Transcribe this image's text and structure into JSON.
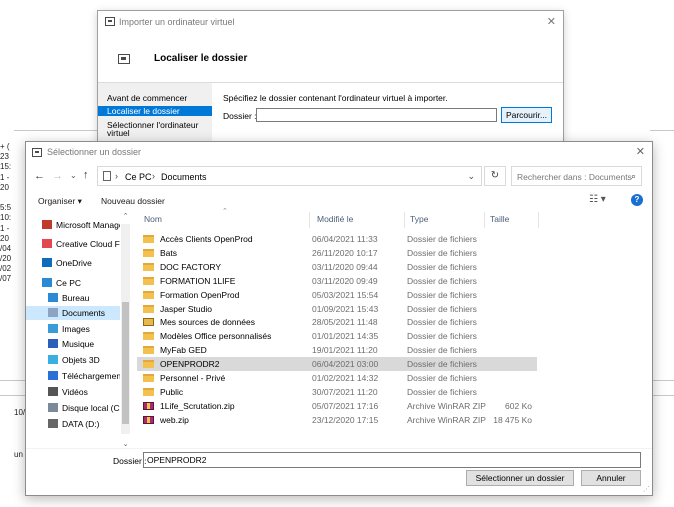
{
  "background": {
    "left_text_lines": [
      "+ (",
      "23",
      "15:",
      "1 -",
      "20",
      "",
      "5:5",
      "10:",
      "1 -",
      "20",
      "/04",
      "/20",
      "/02",
      "/07"
    ],
    "bottom_text_a": "10/",
    "bottom_text_b": "un"
  },
  "import_dialog": {
    "title": "Importer un ordinateur virtuel",
    "close_glyph": "✕",
    "header": "Localiser le dossier",
    "nav": [
      "Avant de commencer",
      "Localiser le dossier",
      "Sélectionner l'ordinateur",
      "virtuel"
    ],
    "instruction": "Spécifiez le dossier contenant l'ordinateur virtuel à importer.",
    "folder_label": "Dossier :",
    "folder_value": "",
    "browse_label": "Parcourir..."
  },
  "folder_dialog": {
    "title": "Sélectionner un dossier",
    "close_glyph": "✕",
    "nav_glyphs": {
      "back": "←",
      "forward": "→",
      "recent": "⌄",
      "up": "↑",
      "sep": "›",
      "dropdown": "⌄",
      "refresh": "↻",
      "search": "⌕",
      "view": "☷ ▾",
      "help": "?",
      "scroll_up": "⌃",
      "scroll_down": "⌄",
      "sort": "⌃",
      "grip": "⋰"
    },
    "breadcrumbs": [
      "Ce PC",
      "Documents"
    ],
    "search_placeholder": "Rechercher dans : Documents",
    "toolbar": {
      "organize": "Organiser ▾",
      "new_folder": "Nouveau dossier"
    },
    "nav_pane": [
      {
        "label": "Microsoft Manage",
        "icon": "microsoft-manage-icon",
        "color": "#c0392b"
      },
      {
        "label": "Creative Cloud Fil",
        "icon": "creative-cloud-icon",
        "color": "#e34850"
      },
      {
        "label": "OneDrive",
        "icon": "onedrive-icon",
        "color": "#0f6cbd"
      },
      {
        "label": "Ce PC",
        "icon": "this-pc-icon",
        "color": "#2b8ad8"
      },
      {
        "label": "Bureau",
        "icon": "desktop-icon",
        "color": "#2b8ad8"
      },
      {
        "label": "Documents",
        "icon": "documents-icon",
        "color": "#8aa4c2"
      },
      {
        "label": "Images",
        "icon": "images-icon",
        "color": "#3a9bd9"
      },
      {
        "label": "Musique",
        "icon": "music-icon",
        "color": "#2b5fb8"
      },
      {
        "label": "Objets 3D",
        "icon": "objects-3d-icon",
        "color": "#3ab0e0"
      },
      {
        "label": "Téléchargements",
        "icon": "downloads-icon",
        "color": "#2b6fd8"
      },
      {
        "label": "Vidéos",
        "icon": "videos-icon",
        "color": "#555555"
      },
      {
        "label": "Disque local (C:)",
        "icon": "local-disk-icon",
        "color": "#7a8a9a"
      },
      {
        "label": "DATA (D:)",
        "icon": "data-drive-icon",
        "color": "#666666"
      }
    ],
    "columns": {
      "name": "Nom",
      "modified": "Modifié le",
      "type": "Type",
      "size": "Taille"
    },
    "files": [
      {
        "name": "Accès Clients OpenProd",
        "modified": "06/04/2021 11:33",
        "type": "Dossier de fichiers",
        "size": "",
        "kind": "folder"
      },
      {
        "name": "Bats",
        "modified": "26/11/2020 10:17",
        "type": "Dossier de fichiers",
        "size": "",
        "kind": "folder"
      },
      {
        "name": "DOC FACTORY",
        "modified": "03/11/2020 09:44",
        "type": "Dossier de fichiers",
        "size": "",
        "kind": "folder"
      },
      {
        "name": "FORMATION 1LIFE",
        "modified": "03/11/2020 09:49",
        "type": "Dossier de fichiers",
        "size": "",
        "kind": "folder"
      },
      {
        "name": "Formation OpenProd",
        "modified": "05/03/2021 15:54",
        "type": "Dossier de fichiers",
        "size": "",
        "kind": "folder"
      },
      {
        "name": "Jasper Studio",
        "modified": "01/09/2021 15:43",
        "type": "Dossier de fichiers",
        "size": "",
        "kind": "folder"
      },
      {
        "name": "Mes sources de données",
        "modified": "28/05/2021 11:48",
        "type": "Dossier de fichiers",
        "size": "",
        "kind": "special"
      },
      {
        "name": "Modèles Office personnalisés",
        "modified": "01/01/2021 14:35",
        "type": "Dossier de fichiers",
        "size": "",
        "kind": "folder"
      },
      {
        "name": "MyFab GED",
        "modified": "19/01/2021 11:20",
        "type": "Dossier de fichiers",
        "size": "",
        "kind": "folder"
      },
      {
        "name": "OPENPRODR2",
        "modified": "06/04/2021 03:00",
        "type": "Dossier de fichiers",
        "size": "",
        "kind": "folder",
        "selected": true
      },
      {
        "name": "Personnel - Privé",
        "modified": "01/02/2021 14:32",
        "type": "Dossier de fichiers",
        "size": "",
        "kind": "folder"
      },
      {
        "name": "Public",
        "modified": "30/07/2021 11:20",
        "type": "Dossier de fichiers",
        "size": "",
        "kind": "folder"
      },
      {
        "name": "1Life_Scrutation.zip",
        "modified": "05/07/2021 17:16",
        "type": "Archive WinRAR ZIP",
        "size": "602 Ko",
        "kind": "zip"
      },
      {
        "name": "web.zip",
        "modified": "23/12/2020 17:15",
        "type": "Archive WinRAR ZIP",
        "size": "18 475 Ko",
        "kind": "zip"
      }
    ],
    "folder_label": "Dossier :",
    "folder_value": "OPENPRODR2",
    "select_label": "Sélectionner un dossier",
    "cancel_label": "Annuler"
  }
}
